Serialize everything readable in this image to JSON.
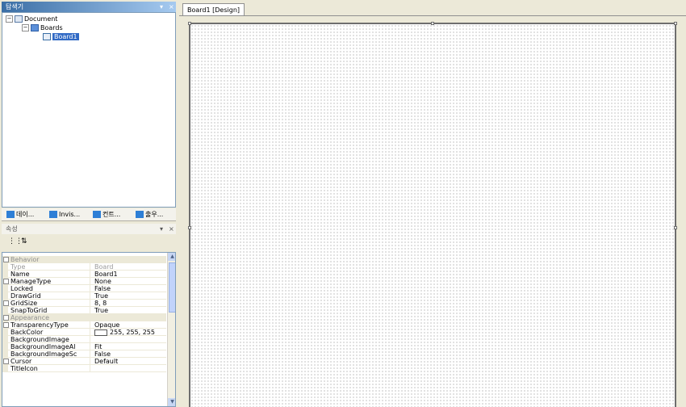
{
  "explorer": {
    "title": "탐색기",
    "buttons": [
      "▾",
      "×"
    ],
    "tree": [
      {
        "label": "Document",
        "expander": "−"
      },
      {
        "label": "Boards",
        "expander": "−"
      },
      {
        "label": "Board1"
      }
    ],
    "tabs": [
      "데이...",
      "Invis...",
      "컨트...",
      "출우..."
    ]
  },
  "properties": {
    "title": "속성",
    "buttons": [
      "▾",
      "×"
    ],
    "toolbar": [
      "⋮⋮",
      "⇅"
    ],
    "rows": [
      {
        "kind": "category",
        "name": "Behavior"
      },
      {
        "kind": "prop",
        "name": "Type",
        "value": "Board",
        "dim": true
      },
      {
        "kind": "prop",
        "name": "Name",
        "value": "Board1"
      },
      {
        "kind": "prop",
        "name": "ManageType",
        "value": "None",
        "expandable": true
      },
      {
        "kind": "prop",
        "name": "Locked",
        "value": "False"
      },
      {
        "kind": "prop",
        "name": "DrawGrid",
        "value": "True"
      },
      {
        "kind": "prop",
        "name": "GridSize",
        "value": "8, 8",
        "expandable": true
      },
      {
        "kind": "prop",
        "name": "SnapToGrid",
        "value": "True"
      },
      {
        "kind": "category",
        "name": "Appearance"
      },
      {
        "kind": "prop",
        "name": "TransparencyType",
        "value": "Opaque",
        "expandable": true
      },
      {
        "kind": "prop",
        "name": "BackColor",
        "value": "255, 255, 255",
        "swatch": "#ffffff"
      },
      {
        "kind": "prop",
        "name": "BackgroundImage",
        "value": ""
      },
      {
        "kind": "prop",
        "name": "BackgroundImageAl",
        "value": "Fit"
      },
      {
        "kind": "prop",
        "name": "BackgroundImageSc",
        "value": "False"
      },
      {
        "kind": "prop",
        "name": "Cursor",
        "value": "Default",
        "expandable": true
      },
      {
        "kind": "prop",
        "name": "TitleIcon",
        "value": ""
      }
    ],
    "scroll_up": "▲",
    "scroll_down": "▼"
  },
  "designer": {
    "tab_label": "Board1 [Design]"
  },
  "colors": {
    "accent": "#316ac5",
    "chrome": "#ece9d8",
    "panel_border": "#7f9db9"
  }
}
